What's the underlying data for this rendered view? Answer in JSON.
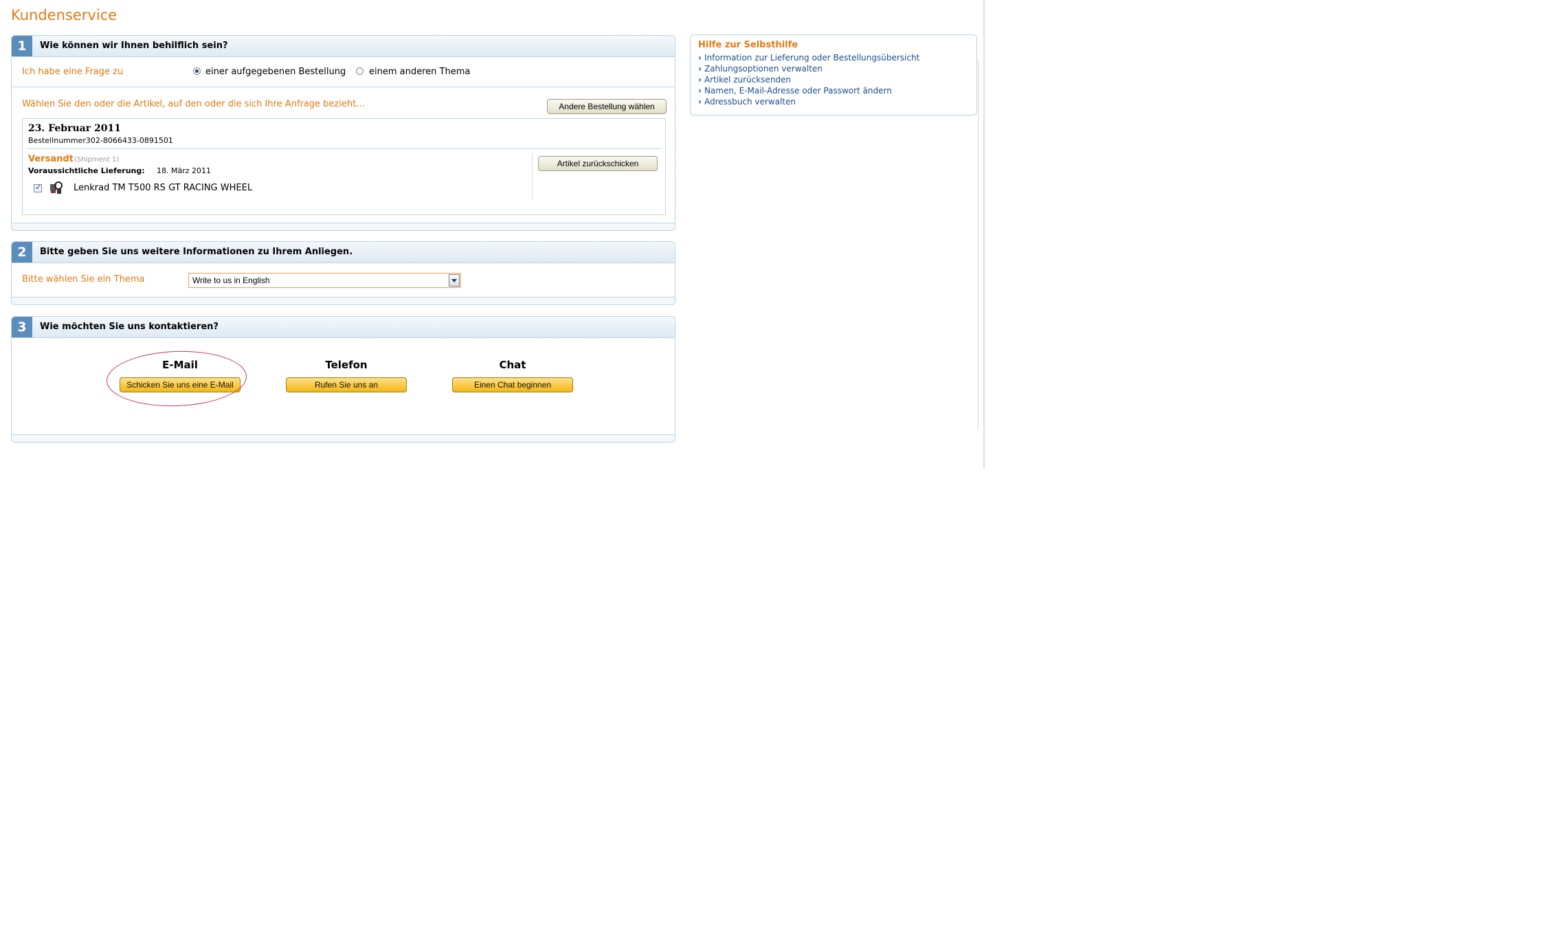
{
  "page": {
    "title": "Kundenservice"
  },
  "section1": {
    "number": "1",
    "title": "Wie können wir Ihnen behilflich sein?",
    "question_label": "Ich habe eine Frage zu",
    "radio_order_label": "einer aufgegebenen Bestellung",
    "radio_other_label": "einem anderen Thema",
    "radio_selected": "order",
    "select_items_label": "Wählen Sie den oder die Artikel, auf den oder die sich Ihre Anfrage bezieht...",
    "other_order_button": "Andere Bestellung wählen",
    "order": {
      "date": "23. Februar 2011",
      "number_label": "Bestellnummer302-8066433-0891501",
      "status": "Versandt",
      "shipment": "(Shipment 1)",
      "delivery_label": "Voraussichtliche Lieferung:",
      "delivery_date": "18. März 2011",
      "return_button": "Artikel zurückschicken",
      "item_name": "Lenkrad TM T500 RS GT RACING WHEEL",
      "item_checked": true
    }
  },
  "section2": {
    "number": "2",
    "title": "Bitte geben Sie uns weitere Informationen zu Ihrem Anliegen.",
    "topic_label": "Bitte wählen Sie ein Thema",
    "topic_value": "Write to us in English"
  },
  "section3": {
    "number": "3",
    "title": "Wie möchten Sie uns kontaktieren?",
    "email_head": "E-Mail",
    "email_button": "Schicken Sie uns eine E-Mail",
    "phone_head": "Telefon",
    "phone_button": "Rufen Sie uns an",
    "chat_head": "Chat",
    "chat_button": "Einen Chat beginnen"
  },
  "help": {
    "title": "Hilfe zur Selbsthilfe",
    "links": [
      "Information zur Lieferung oder Bestellungsübersicht",
      "Zahlungsoptionen verwalten",
      "Artikel zurücksenden",
      "Namen, E-Mail-Adresse oder Passwort ändern",
      "Adressbuch verwalten"
    ]
  },
  "colors": {
    "accent": "#e47911",
    "link": "#1c4d8c",
    "border": "#bcd5e6",
    "annotation": "#c8375a"
  }
}
